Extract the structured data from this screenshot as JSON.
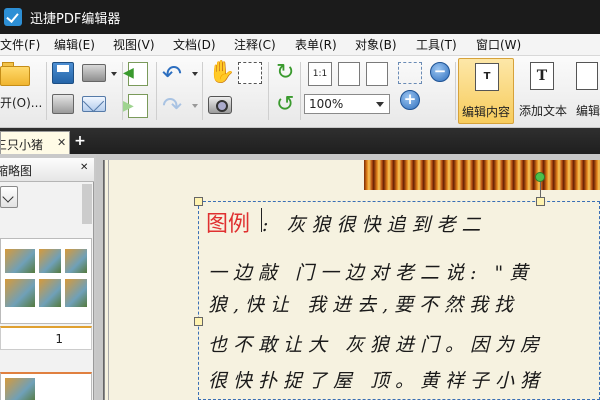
{
  "window": {
    "title": "迅捷PDF编辑器"
  },
  "menu": [
    "文件(F)",
    "编辑(E)",
    "视图(V)",
    "文档(D)",
    "注释(C)",
    "表单(R)",
    "对象(B)",
    "工具(T)",
    "窗口(W)"
  ],
  "toolbar": {
    "open_label": "开(O)...",
    "zoom_value": "100%",
    "actual_size_label": "1:1",
    "edit_content_label": "编辑内容",
    "add_text_label": "添加文本",
    "edit_cut_label": "编辑"
  },
  "tabs": {
    "active": "三只小猪",
    "add_symbol": "+",
    "close_symbol": "✕"
  },
  "thumbnails": {
    "title": "缩略图",
    "page_number": "1"
  },
  "document": {
    "legend": "图例",
    "lines": [
      ":        灰狼很快追到老二",
      "一边敲  门一边对老二说: \"黄",
      "狼,快让  我进去,要不然我找",
      "也不敢让大  灰狼进门。因为房",
      "很快扑捉了屋  顶。黄祥子小猪"
    ]
  }
}
